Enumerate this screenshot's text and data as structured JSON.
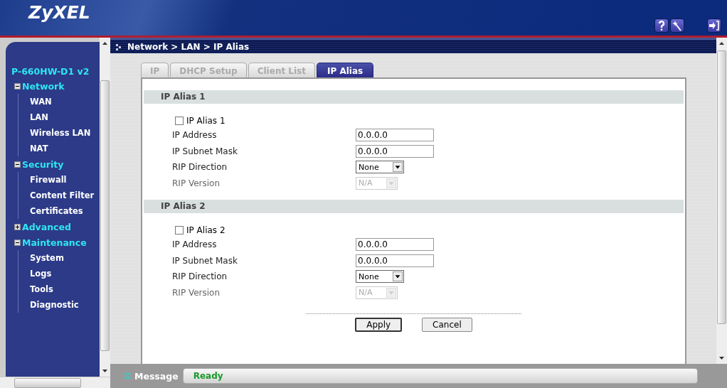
{
  "header": {
    "logo": "ZyXEL"
  },
  "sidebar": {
    "device": "P-660HW-D1 v2",
    "items": [
      {
        "label": "Network",
        "expanded": true,
        "children": [
          {
            "label": "WAN"
          },
          {
            "label": "LAN"
          },
          {
            "label": "Wireless LAN"
          },
          {
            "label": "NAT"
          }
        ]
      },
      {
        "label": "Security",
        "expanded": true,
        "children": [
          {
            "label": "Firewall"
          },
          {
            "label": "Content Filter"
          },
          {
            "label": "Certificates"
          }
        ]
      },
      {
        "label": "Advanced",
        "expanded": false
      },
      {
        "label": "Maintenance",
        "expanded": true,
        "children": [
          {
            "label": "System"
          },
          {
            "label": "Logs"
          },
          {
            "label": "Tools"
          },
          {
            "label": "Diagnostic"
          }
        ]
      }
    ]
  },
  "breadcrumb": "Network > LAN > IP Alias",
  "tabs": [
    {
      "label": "IP",
      "selected": false
    },
    {
      "label": "DHCP Setup",
      "selected": false
    },
    {
      "label": "Client List",
      "selected": false
    },
    {
      "label": "IP Alias",
      "selected": true
    }
  ],
  "sections": [
    {
      "title": "IP Alias 1",
      "checkbox": {
        "label": "IP Alias 1",
        "checked": false
      },
      "fields": [
        {
          "label": "IP Address",
          "kind": "text",
          "value": "0.0.0.0",
          "disabled": false
        },
        {
          "label": "IP Subnet Mask",
          "kind": "text",
          "value": "0.0.0.0",
          "disabled": false
        },
        {
          "label": "RIP Direction",
          "kind": "select",
          "value": "None",
          "disabled": false
        },
        {
          "label": "RIP Version",
          "kind": "select",
          "value": "N/A",
          "disabled": true
        }
      ]
    },
    {
      "title": "IP Alias 2",
      "checkbox": {
        "label": "IP Alias 2",
        "checked": false
      },
      "fields": [
        {
          "label": "IP Address",
          "kind": "text",
          "value": "0.0.0.0",
          "disabled": false
        },
        {
          "label": "IP Subnet Mask",
          "kind": "text",
          "value": "0.0.0.0",
          "disabled": false
        },
        {
          "label": "RIP Direction",
          "kind": "select",
          "value": "None",
          "disabled": false
        },
        {
          "label": "RIP Version",
          "kind": "select",
          "value": "N/A",
          "disabled": true
        }
      ]
    }
  ],
  "buttons": [
    "Apply",
    "Cancel"
  ],
  "status_bar": {
    "label": "Message",
    "value": "Ready"
  }
}
